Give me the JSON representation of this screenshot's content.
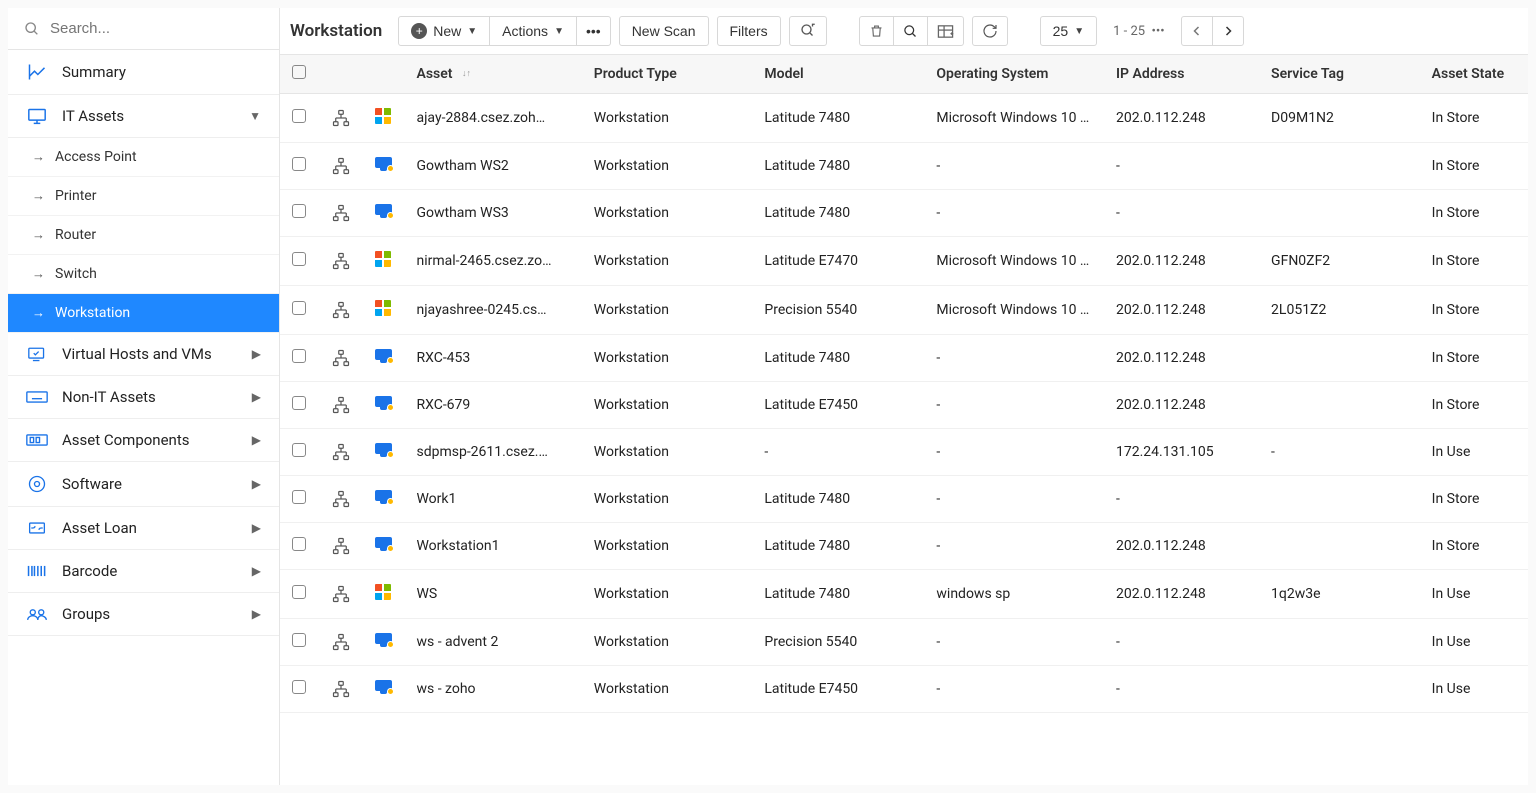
{
  "search": {
    "placeholder": "Search..."
  },
  "sidebar": {
    "summary": "Summary",
    "it_assets": "IT Assets",
    "subs": [
      {
        "label": "Access Point"
      },
      {
        "label": "Printer"
      },
      {
        "label": "Router"
      },
      {
        "label": "Switch"
      },
      {
        "label": "Workstation",
        "active": true
      }
    ],
    "virtual_hosts": "Virtual Hosts and VMs",
    "non_it": "Non-IT Assets",
    "components": "Asset Components",
    "software": "Software",
    "loan": "Asset Loan",
    "barcode": "Barcode",
    "groups": "Groups"
  },
  "page": {
    "title": "Workstation"
  },
  "toolbar": {
    "new": "New",
    "actions": "Actions",
    "new_scan": "New Scan",
    "filters": "Filters",
    "page_size": "25",
    "range": "1 - 25"
  },
  "columns": {
    "asset": "Asset",
    "product_type": "Product Type",
    "model": "Model",
    "os": "Operating System",
    "ip": "IP Address",
    "tag": "Service Tag",
    "state": "Asset State"
  },
  "rows": [
    {
      "icon": "win",
      "asset": "ajay-2884.csez.zoh…",
      "ptype": "Workstation",
      "model": "Latitude 7480",
      "os": "Microsoft Windows 10 …",
      "ip": "202.0.112.248",
      "tag": "D09M1N2",
      "state": "In Store"
    },
    {
      "icon": "mon",
      "asset": "Gowtham WS2",
      "ptype": "Workstation",
      "model": "Latitude 7480",
      "os": "-",
      "ip": "-",
      "tag": "",
      "state": "In Store"
    },
    {
      "icon": "mon",
      "asset": "Gowtham WS3",
      "ptype": "Workstation",
      "model": "Latitude 7480",
      "os": "-",
      "ip": "-",
      "tag": "",
      "state": "In Store"
    },
    {
      "icon": "win",
      "asset": "nirmal-2465.csez.zo…",
      "ptype": "Workstation",
      "model": "Latitude E7470",
      "os": "Microsoft Windows 10 …",
      "ip": "202.0.112.248",
      "tag": "GFN0ZF2",
      "state": "In Store"
    },
    {
      "icon": "win",
      "asset": "njayashree-0245.cs…",
      "ptype": "Workstation",
      "model": "Precision 5540",
      "os": "Microsoft Windows 10 …",
      "ip": "202.0.112.248",
      "tag": "2L051Z2",
      "state": "In Store"
    },
    {
      "icon": "mon",
      "asset": "RXC-453",
      "ptype": "Workstation",
      "model": "Latitude 7480",
      "os": "-",
      "ip": "202.0.112.248",
      "tag": "",
      "state": "In Store"
    },
    {
      "icon": "mon",
      "asset": "RXC-679",
      "ptype": "Workstation",
      "model": "Latitude E7450",
      "os": "-",
      "ip": "202.0.112.248",
      "tag": "",
      "state": "In Store"
    },
    {
      "icon": "mon",
      "asset": "sdpmsp-2611.csez.…",
      "ptype": "Workstation",
      "model": "-",
      "os": "-",
      "ip": "172.24.131.105",
      "tag": "-",
      "state": "In Use"
    },
    {
      "icon": "mon",
      "asset": "Work1",
      "ptype": "Workstation",
      "model": "Latitude 7480",
      "os": "-",
      "ip": "-",
      "tag": "",
      "state": "In Store"
    },
    {
      "icon": "mon",
      "asset": "Workstation1",
      "ptype": "Workstation",
      "model": "Latitude 7480",
      "os": "-",
      "ip": "202.0.112.248",
      "tag": "",
      "state": "In Store"
    },
    {
      "icon": "win",
      "asset": "WS",
      "ptype": "Workstation",
      "model": "Latitude 7480",
      "os": "windows sp",
      "ip": "202.0.112.248",
      "tag": "1q2w3e",
      "state": "In Use"
    },
    {
      "icon": "mon",
      "asset": "ws - advent 2",
      "ptype": "Workstation",
      "model": "Precision 5540",
      "os": "-",
      "ip": "-",
      "tag": "",
      "state": "In Use"
    },
    {
      "icon": "mon",
      "asset": "ws - zoho",
      "ptype": "Workstation",
      "model": "Latitude E7450",
      "os": "-",
      "ip": "-",
      "tag": "",
      "state": "In Use"
    }
  ]
}
